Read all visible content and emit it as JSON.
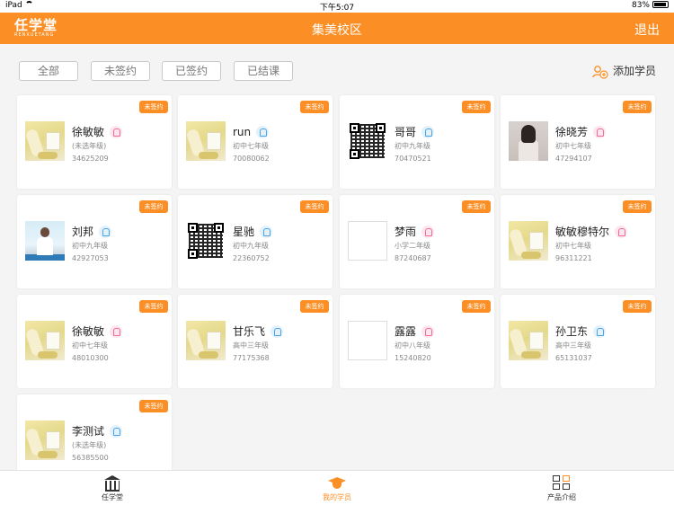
{
  "status_bar": {
    "device": "iPad",
    "time": "下午5:07",
    "battery": "83%",
    "battery_level": 0.83
  },
  "header": {
    "logo_main": "任学堂",
    "logo_sub": "RENXUETANG",
    "title": "集美校区",
    "logout_label": "退出"
  },
  "filters": [
    {
      "label": "全部",
      "active": false
    },
    {
      "label": "未签约",
      "active": true
    },
    {
      "label": "已签约",
      "active": false
    },
    {
      "label": "已结课",
      "active": false
    }
  ],
  "add_student_label": "添加学员",
  "cards": [
    {
      "tag": "未签约",
      "name": "徐敏敏",
      "gender": "female",
      "grade": "(未选年级)",
      "id": "34625209",
      "avatar": "photo"
    },
    {
      "tag": "未签约",
      "name": "run",
      "gender": "male",
      "grade": "初中七年级",
      "id": "70080062",
      "avatar": "photo"
    },
    {
      "tag": "未签约",
      "name": "哥哥",
      "gender": "male",
      "grade": "初中九年级",
      "id": "70470521",
      "avatar": "qr"
    },
    {
      "tag": "未签约",
      "name": "徐晓芳",
      "gender": "female",
      "grade": "初中七年级",
      "id": "47294107",
      "avatar": "girl"
    },
    {
      "tag": "未签约",
      "name": "刘邦",
      "gender": "male",
      "grade": "初中九年级",
      "id": "42927053",
      "avatar": "man"
    },
    {
      "tag": "未签约",
      "name": "星驰",
      "gender": "male",
      "grade": "初中九年级",
      "id": "22360752",
      "avatar": "qr"
    },
    {
      "tag": "未签约",
      "name": "梦雨",
      "gender": "female",
      "grade": "小学二年级",
      "id": "87240687",
      "avatar": "blank"
    },
    {
      "tag": "未签约",
      "name": "敏敏穆特尔",
      "gender": "female",
      "grade": "初中七年级",
      "id": "96311221",
      "avatar": "photo"
    },
    {
      "tag": "未签约",
      "name": "徐敏敏",
      "gender": "female",
      "grade": "初中七年级",
      "id": "48010300",
      "avatar": "photo"
    },
    {
      "tag": "未签约",
      "name": "甘乐飞",
      "gender": "male",
      "grade": "高中三年级",
      "id": "77175368",
      "avatar": "photo"
    },
    {
      "tag": "未签约",
      "name": "露露",
      "gender": "female",
      "grade": "初中八年级",
      "id": "15240820",
      "avatar": "blank"
    },
    {
      "tag": "未签约",
      "name": "孙卫东",
      "gender": "male",
      "grade": "高中三年级",
      "id": "65131037",
      "avatar": "photo"
    },
    {
      "tag": "未签约",
      "name": "李测试",
      "gender": "male",
      "grade": "(未选年级)",
      "id": "56385500",
      "avatar": "photo"
    }
  ],
  "tabs": [
    {
      "label": "任学堂",
      "icon": "bank-icon",
      "active": false
    },
    {
      "label": "我的学员",
      "icon": "graduation-cap-icon",
      "active": true
    },
    {
      "label": "产品介绍",
      "icon": "grid-icon",
      "active": false
    }
  ],
  "colors": {
    "accent": "#fb8f25",
    "female": "#f26c9a",
    "male": "#4aa3e6"
  }
}
